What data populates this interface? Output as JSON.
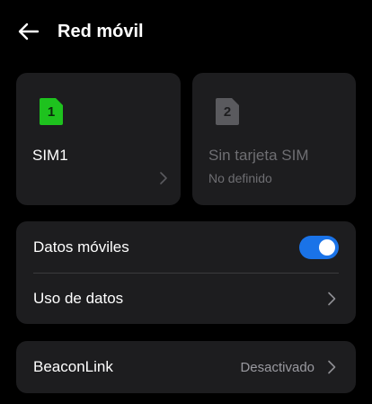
{
  "header": {
    "title": "Red móvil",
    "back_icon": "arrow-left-icon"
  },
  "sim_cards": [
    {
      "number": "1",
      "name": "SIM1",
      "status": "",
      "icon": "sim-card-icon",
      "icon_color": "#1ec21e"
    },
    {
      "number": "2",
      "name": "Sin tarjeta SIM",
      "status": "No definido",
      "icon": "sim-card-icon",
      "icon_color": "#5a5a5e"
    }
  ],
  "mobile_settings": {
    "mobile_data": {
      "label": "Datos móviles",
      "enabled": true
    },
    "data_usage": {
      "label": "Uso de datos",
      "icon": "chevron-right-icon"
    }
  },
  "beaconlink": {
    "label": "BeaconLink",
    "value": "Desactivado",
    "icon": "chevron-right-icon"
  },
  "colors": {
    "background": "#000000",
    "card": "#1d1d1f",
    "accent": "#1a73e8",
    "sim_active": "#1ec21e",
    "sim_inactive": "#5a5a5e",
    "secondary_text": "#6e6e72"
  }
}
